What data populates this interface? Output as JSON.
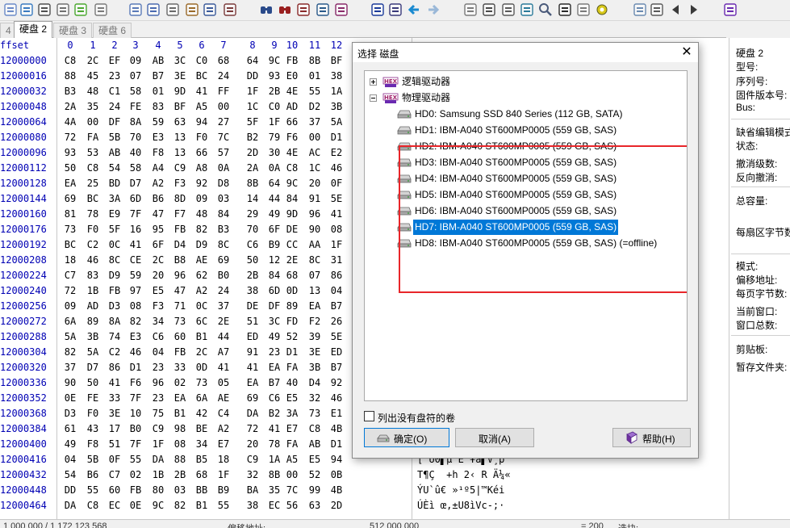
{
  "toolbar": {
    "icons": [
      "new-file-icon",
      "save-icon",
      "print-icon",
      "properties-icon",
      "open-folder-icon",
      "move-up-icon",
      "undo-icon",
      "copy-icon",
      "copy-block-icon",
      "paste-icon",
      "paste-write-icon",
      "hex-binary-icon",
      "find-icon",
      "find-next-icon",
      "find-hex-icon",
      "replace-icon",
      "replace-hex-icon",
      "goto-offset-icon",
      "goto-sector-icon",
      "back-icon",
      "forward-icon",
      "disk-icon",
      "disk-open-icon",
      "disk-tools-icon",
      "ram-icon",
      "search-magnify-icon",
      "dark-mode-icon",
      "speech-icon",
      "settings-gear-icon",
      "checkbox-grid-icon",
      "list-icon",
      "prev-icon",
      "next-icon",
      "help-book-icon"
    ]
  },
  "tabs": [
    {
      "label": "4"
    },
    {
      "label": "硬盘 2"
    },
    {
      "label": "硬盘 3"
    },
    {
      "label": "硬盘 6"
    }
  ],
  "hex": {
    "offset_header": "ffset",
    "columns": [
      "0",
      "1",
      "2",
      "3",
      "4",
      "5",
      "6",
      "7",
      "8",
      "9",
      "10",
      "11",
      "12"
    ],
    "rows": [
      {
        "offset": "12000000",
        "bytes": [
          "C8",
          "2C",
          "EF",
          "09",
          "AB",
          "3C",
          "C0",
          "68",
          "64",
          "9C",
          "FB",
          "8B",
          "BF"
        ],
        "text": ""
      },
      {
        "offset": "12000016",
        "bytes": [
          "88",
          "45",
          "23",
          "07",
          "B7",
          "3E",
          "BC",
          "24",
          "DD",
          "93",
          "E0",
          "01",
          "38"
        ],
        "text": ""
      },
      {
        "offset": "12000032",
        "bytes": [
          "B3",
          "48",
          "C1",
          "58",
          "01",
          "9D",
          "41",
          "FF",
          "1F",
          "2B",
          "4E",
          "55",
          "1A"
        ],
        "text": ""
      },
      {
        "offset": "12000048",
        "bytes": [
          "2A",
          "35",
          "24",
          "FE",
          "83",
          "BF",
          "A5",
          "00",
          "1C",
          "C0",
          "AD",
          "D2",
          "3B"
        ],
        "text": ""
      },
      {
        "offset": "12000064",
        "bytes": [
          "4A",
          "00",
          "DF",
          "8A",
          "59",
          "63",
          "94",
          "27",
          "5F",
          "1F",
          "66",
          "37",
          "5A"
        ],
        "text": ""
      },
      {
        "offset": "12000080",
        "bytes": [
          "72",
          "FA",
          "5B",
          "70",
          "E3",
          "13",
          "F0",
          "7C",
          "B2",
          "79",
          "F6",
          "00",
          "D1"
        ],
        "text": ""
      },
      {
        "offset": "12000096",
        "bytes": [
          "93",
          "53",
          "AB",
          "40",
          "F8",
          "13",
          "66",
          "57",
          "2D",
          "30",
          "4E",
          "AC",
          "E2"
        ],
        "text": ""
      },
      {
        "offset": "12000112",
        "bytes": [
          "50",
          "C8",
          "54",
          "58",
          "A4",
          "C9",
          "A8",
          "0A",
          "2A",
          "0A",
          "C8",
          "1C",
          "46"
        ],
        "text": ""
      },
      {
        "offset": "12000128",
        "bytes": [
          "EA",
          "25",
          "BD",
          "D7",
          "A2",
          "F3",
          "92",
          "D8",
          "8B",
          "64",
          "9C",
          "20",
          "0F"
        ],
        "text": ""
      },
      {
        "offset": "12000144",
        "bytes": [
          "69",
          "BC",
          "3A",
          "6D",
          "B6",
          "8D",
          "09",
          "03",
          "14",
          "44",
          "84",
          "91",
          "5E"
        ],
        "text": ""
      },
      {
        "offset": "12000160",
        "bytes": [
          "81",
          "78",
          "E9",
          "7F",
          "47",
          "F7",
          "48",
          "84",
          "29",
          "49",
          "9D",
          "96",
          "41"
        ],
        "text": ""
      },
      {
        "offset": "12000176",
        "bytes": [
          "73",
          "F0",
          "5F",
          "16",
          "95",
          "FB",
          "82",
          "B3",
          "70",
          "6F",
          "DE",
          "90",
          "08"
        ],
        "text": ""
      },
      {
        "offset": "12000192",
        "bytes": [
          "BC",
          "C2",
          "0C",
          "41",
          "6F",
          "D4",
          "D9",
          "8C",
          "C6",
          "B9",
          "CC",
          "AA",
          "1F"
        ],
        "text": ""
      },
      {
        "offset": "12000208",
        "bytes": [
          "18",
          "46",
          "8C",
          "CE",
          "2C",
          "B8",
          "AE",
          "69",
          "50",
          "12",
          "2E",
          "8C",
          "31"
        ],
        "text": ""
      },
      {
        "offset": "12000224",
        "bytes": [
          "C7",
          "83",
          "D9",
          "59",
          "20",
          "96",
          "62",
          "B0",
          "2B",
          "84",
          "68",
          "07",
          "86"
        ],
        "text": ""
      },
      {
        "offset": "12000240",
        "bytes": [
          "72",
          "1B",
          "FB",
          "97",
          "E5",
          "47",
          "A2",
          "24",
          "38",
          "6D",
          "0D",
          "13",
          "04"
        ],
        "text": ""
      },
      {
        "offset": "12000256",
        "bytes": [
          "09",
          "AD",
          "D3",
          "08",
          "F3",
          "71",
          "0C",
          "37",
          "DE",
          "DF",
          "89",
          "EA",
          "B7"
        ],
        "text": ""
      },
      {
        "offset": "12000272",
        "bytes": [
          "6A",
          "89",
          "8A",
          "82",
          "34",
          "73",
          "6C",
          "2E",
          "51",
          "3C",
          "FD",
          "F2",
          "26"
        ],
        "text": ""
      },
      {
        "offset": "12000288",
        "bytes": [
          "5A",
          "3B",
          "74",
          "E3",
          "C6",
          "60",
          "B1",
          "44",
          "ED",
          "49",
          "52",
          "39",
          "5E"
        ],
        "text": ""
      },
      {
        "offset": "12000304",
        "bytes": [
          "82",
          "5A",
          "C2",
          "46",
          "04",
          "FB",
          "2C",
          "A7",
          "91",
          "23",
          "D1",
          "3E",
          "ED"
        ],
        "text": ""
      },
      {
        "offset": "12000320",
        "bytes": [
          "37",
          "D7",
          "86",
          "D1",
          "23",
          "33",
          "0D",
          "41",
          "41",
          "EA",
          "FA",
          "3B",
          "B7"
        ],
        "text": ""
      },
      {
        "offset": "12000336",
        "bytes": [
          "90",
          "50",
          "41",
          "F6",
          "96",
          "02",
          "73",
          "05",
          "EA",
          "B7",
          "40",
          "D4",
          "92"
        ],
        "text": ""
      },
      {
        "offset": "12000352",
        "bytes": [
          "0E",
          "FE",
          "33",
          "7F",
          "23",
          "EA",
          "6A",
          "AE",
          "69",
          "C6",
          "E5",
          "32",
          "46"
        ],
        "text": ""
      },
      {
        "offset": "12000368",
        "bytes": [
          "D3",
          "F0",
          "3E",
          "10",
          "75",
          "B1",
          "42",
          "C4",
          "DA",
          "B2",
          "3A",
          "73",
          "E1"
        ],
        "text": ""
      },
      {
        "offset": "12000384",
        "bytes": [
          "61",
          "43",
          "17",
          "B0",
          "C9",
          "98",
          "BE",
          "A2",
          "72",
          "41",
          "E7",
          "C8",
          "4B"
        ],
        "text": ""
      },
      {
        "offset": "12000400",
        "bytes": [
          "49",
          "F8",
          "51",
          "7F",
          "1F",
          "08",
          "34",
          "E7",
          "20",
          "78",
          "FA",
          "AB",
          "D1"
        ],
        "text": ""
      },
      {
        "offset": "12000416",
        "bytes": [
          "04",
          "5B",
          "0F",
          "55",
          "DA",
          "88",
          "B5",
          "18",
          "C9",
          "1A",
          "A5",
          "E5",
          "94"
        ],
        "text": "[ U0▌µ E ¥å▌V¸p"
      },
      {
        "offset": "12000432",
        "bytes": [
          "54",
          "B6",
          "C7",
          "02",
          "1B",
          "2B",
          "68",
          "1F",
          "32",
          "8B",
          "00",
          "52",
          "0B"
        ],
        "text": "T¶Ç  +h 2‹ R Ä¼«"
      },
      {
        "offset": "12000448",
        "bytes": [
          "DD",
          "55",
          "60",
          "FB",
          "80",
          "03",
          "BB",
          "B9",
          "BA",
          "35",
          "7C",
          "99",
          "4B"
        ],
        "text": "ÝU`û€ »¹º5|™Kéi"
      },
      {
        "offset": "12000464",
        "bytes": [
          "DA",
          "C8",
          "EC",
          "0E",
          "9C",
          "82",
          "B1",
          "55",
          "38",
          "EC",
          "56",
          "63",
          "2D"
        ],
        "text": "ÚÈì œ‚±U8ìVc-;·"
      }
    ]
  },
  "info": {
    "disk": "硬盘 2",
    "model_label": "型号:",
    "serial_label": "序列号:",
    "firmware_label": "固件版本号:",
    "bus_label": "Bus:",
    "edit_mode_label": "缺省编辑模式",
    "state_label": "状态:",
    "undo_level_label": "撤消级数:",
    "redo_label": "反向撤消:",
    "capacity_label": "总容量:",
    "bytes_per_sector_label": "每扇区字节数",
    "mode_label": "模式:",
    "offset_label": "偏移地址:",
    "bytes_per_page_label": "每页字节数:",
    "current_window_label": "当前窗口:",
    "window_count_label": "窗口总数:",
    "clipboard_label": "剪贴板:",
    "temp_folder_label": "暂存文件夹:"
  },
  "statusbar": {
    "position": "1 000 000 / 1 172 123 568",
    "offset_label": "偏移地址:",
    "offset_value": "512 000 000",
    "eq": "= 200",
    "selection_label": "选块:"
  },
  "dialog": {
    "title": "选择 磁盘",
    "tree": {
      "logical": "逻辑驱动器",
      "physical": "物理驱动器",
      "drives": [
        {
          "label": "HD0: Samsung SSD 840 Series (112 GB, SATA)",
          "selected": false
        },
        {
          "label": "HD1: IBM-A040 ST600MP0005 (559 GB, SAS)",
          "selected": false
        },
        {
          "label": "HD2: IBM-A040 ST600MP0005 (559 GB, SAS)",
          "selected": false
        },
        {
          "label": "HD3: IBM-A040 ST600MP0005 (559 GB, SAS)",
          "selected": false
        },
        {
          "label": "HD4: IBM-A040 ST600MP0005 (559 GB, SAS)",
          "selected": false
        },
        {
          "label": "HD5: IBM-A040 ST600MP0005 (559 GB, SAS)",
          "selected": false
        },
        {
          "label": "HD6: IBM-A040 ST600MP0005 (559 GB, SAS)",
          "selected": false
        },
        {
          "label": "HD7: IBM-A040 ST600MP0005 (559 GB, SAS)",
          "selected": true
        },
        {
          "label": "HD8: IBM-A040 ST600MP0005 (559 GB, SAS) (=offline)",
          "selected": false
        }
      ]
    },
    "checkbox_label": "列出没有盘符的卷",
    "ok_label": "确定(O)",
    "cancel_label": "取消(A)",
    "help_label": "帮助(H)",
    "hex_icon_text": "HEX"
  },
  "colors": {
    "accent": "#0078d7",
    "offset_blue": "#0000b4",
    "highlight_red": "#e8262a"
  }
}
